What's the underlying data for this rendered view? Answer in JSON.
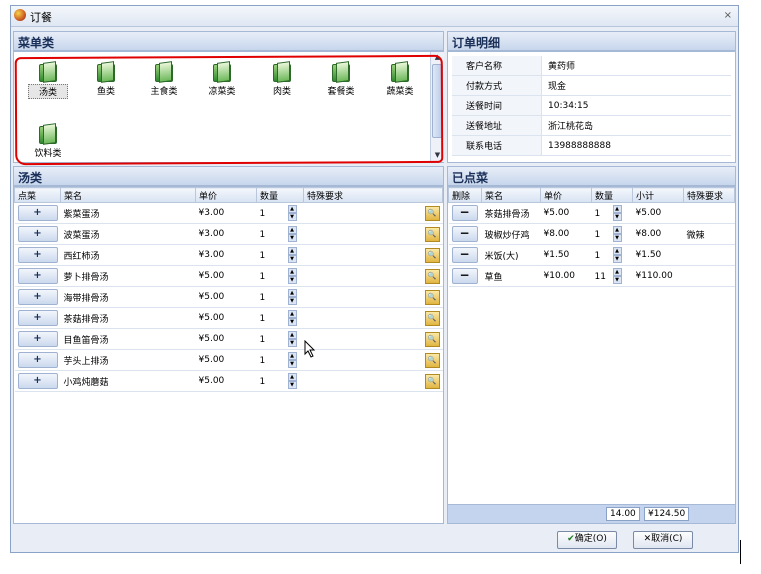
{
  "window": {
    "title": "订餐",
    "close_label": "×"
  },
  "menu_categories": {
    "heading": "菜单类",
    "items": [
      "汤类",
      "鱼类",
      "主食类",
      "凉菜类",
      "肉类",
      "套餐类",
      "蔬菜类",
      "饮料类"
    ],
    "selected": "汤类"
  },
  "dish_list": {
    "heading": "汤类",
    "columns": [
      "点菜",
      "菜名",
      "单价",
      "数量",
      "特殊要求"
    ],
    "add_label": "+",
    "rows": [
      {
        "name": "紫菜蛋汤",
        "price": "¥3.00",
        "qty": "1"
      },
      {
        "name": "波菜蛋汤",
        "price": "¥3.00",
        "qty": "1"
      },
      {
        "name": "西红柿汤",
        "price": "¥3.00",
        "qty": "1"
      },
      {
        "name": "萝卜排骨汤",
        "price": "¥5.00",
        "qty": "1"
      },
      {
        "name": "海带排骨汤",
        "price": "¥5.00",
        "qty": "1"
      },
      {
        "name": "茶菇排骨汤",
        "price": "¥5.00",
        "qty": "1"
      },
      {
        "name": "目鱼笛骨汤",
        "price": "¥5.00",
        "qty": "1"
      },
      {
        "name": "芋头上排汤",
        "price": "¥5.00",
        "qty": "1"
      },
      {
        "name": "小鸡炖蘑菇",
        "price": "¥5.00",
        "qty": "1"
      }
    ]
  },
  "order_detail": {
    "heading": "订单明细",
    "fields": [
      {
        "label": "客户名称",
        "value": "黄药师"
      },
      {
        "label": "付款方式",
        "value": "现金"
      },
      {
        "label": "送餐时间",
        "value": "10:34:15"
      },
      {
        "label": "送餐地址",
        "value": "浙江桃花岛"
      },
      {
        "label": "联系电话",
        "value": "13988888888"
      }
    ]
  },
  "ordered": {
    "heading": "已点菜",
    "columns": [
      "删除",
      "菜名",
      "单价",
      "数量",
      "小计",
      "特殊要求"
    ],
    "delete_label": "−",
    "rows": [
      {
        "name": "茶菇排骨汤",
        "price": "¥5.00",
        "qty": "1",
        "subtotal": "¥5.00",
        "note": ""
      },
      {
        "name": "玻椒炒仔鸡",
        "price": "¥8.00",
        "qty": "1",
        "subtotal": "¥8.00",
        "note": "微辣"
      },
      {
        "name": "米饭(大)",
        "price": "¥1.50",
        "qty": "1",
        "subtotal": "¥1.50",
        "note": ""
      },
      {
        "name": "草鱼",
        "price": "¥10.00",
        "qty": "11",
        "subtotal": "¥110.00",
        "note": ""
      }
    ],
    "total_qty": "14.00",
    "total_amount": "¥124.50"
  },
  "buttons": {
    "ok": "确定(O)",
    "cancel": "取消(C)"
  },
  "colors": {
    "accent": "#c7d6ec",
    "highlight": "#e00000"
  }
}
